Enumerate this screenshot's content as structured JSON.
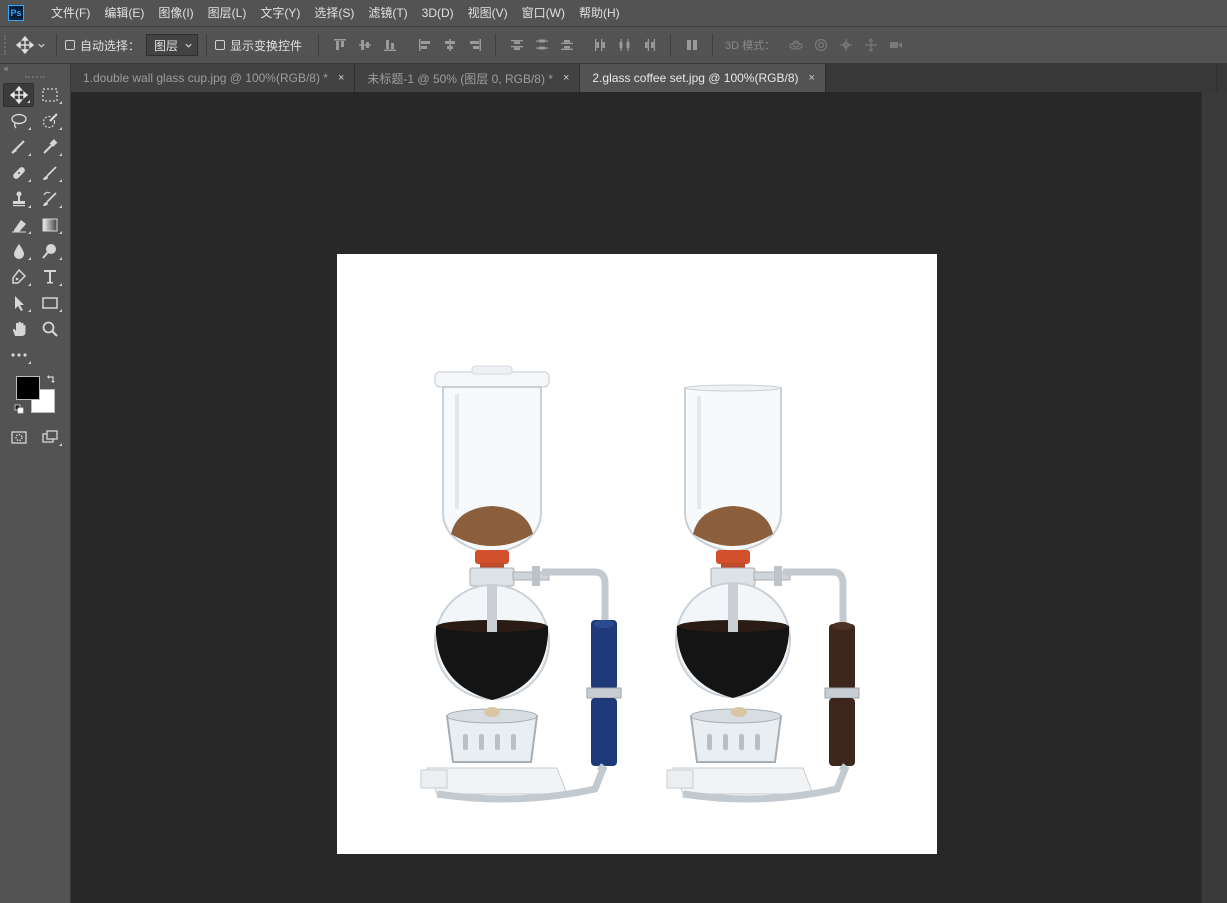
{
  "app": {
    "logo_text": "Ps"
  },
  "menu": {
    "items": [
      "文件(F)",
      "编辑(E)",
      "图像(I)",
      "图层(L)",
      "文字(Y)",
      "选择(S)",
      "滤镜(T)",
      "3D(D)",
      "视图(V)",
      "窗口(W)",
      "帮助(H)"
    ]
  },
  "options": {
    "auto_select_label": "自动选择：",
    "auto_select_checked": false,
    "layer_select_value": "图层",
    "show_transform_label": "显示变换控件",
    "show_transform_checked": false,
    "mode3d_label": "3D 模式："
  },
  "toolbar": {
    "collapse_glyph": "«"
  },
  "tabs": [
    {
      "label": "1.double wall glass cup.jpg @ 100%(RGB/8) *",
      "active": false,
      "close": "×"
    },
    {
      "label": "未标题-1 @ 50% (图层 0, RGB/8) *",
      "active": false,
      "close": "×"
    },
    {
      "label": "2.glass coffee set.jpg @ 100%(RGB/8)",
      "active": true,
      "close": "×"
    }
  ],
  "colors": {
    "foreground": "#000000",
    "background": "#ffffff"
  }
}
